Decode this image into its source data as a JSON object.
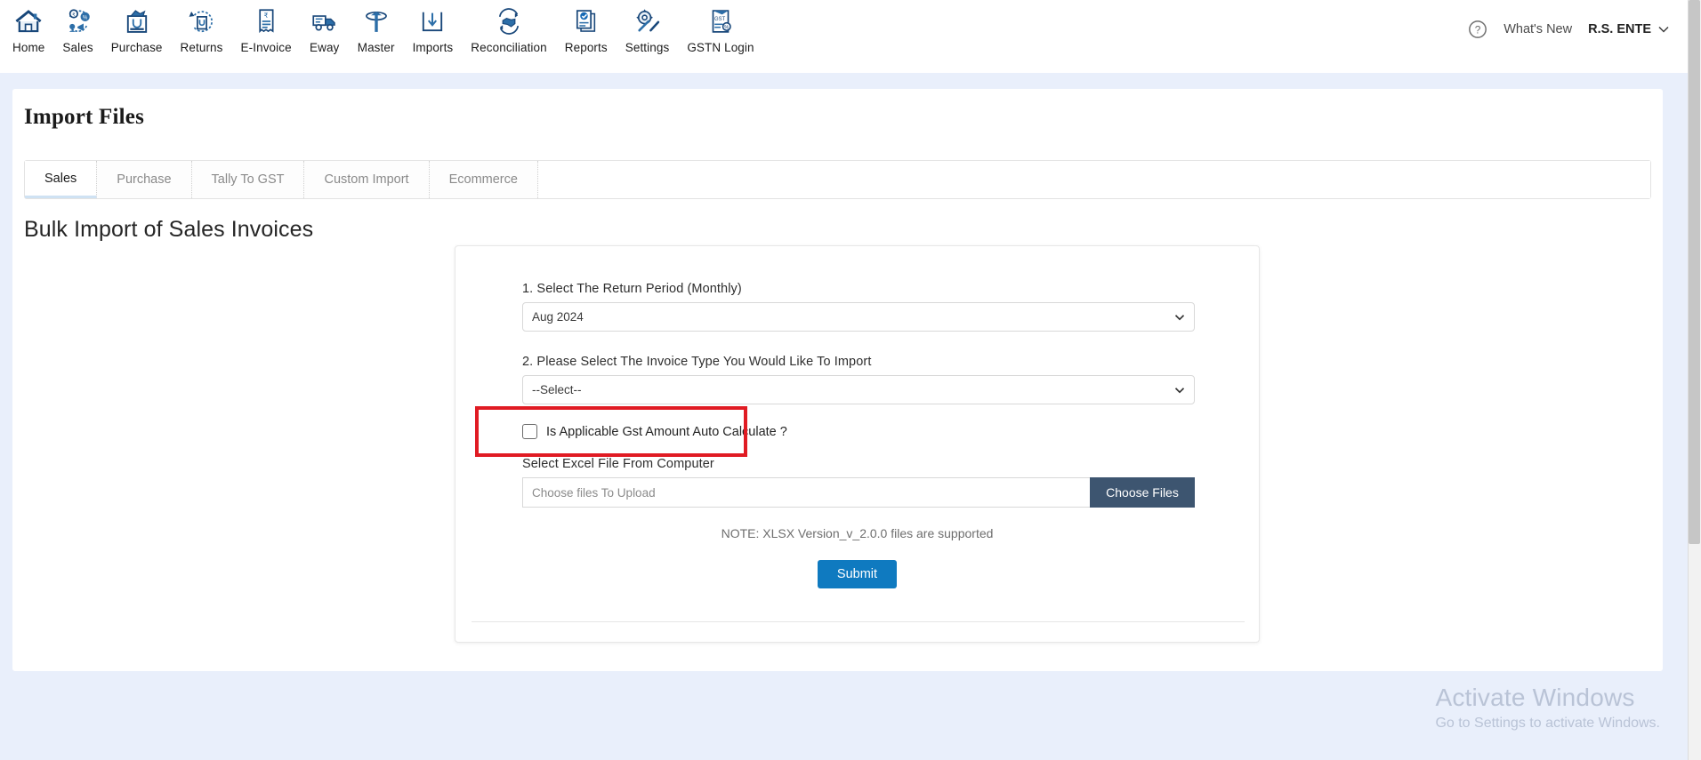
{
  "header": {
    "nav_items": [
      {
        "label": "Home",
        "icon": "home-icon"
      },
      {
        "label": "Sales",
        "icon": "sales-icon"
      },
      {
        "label": "Purchase",
        "icon": "purchase-icon"
      },
      {
        "label": "Returns",
        "icon": "returns-icon"
      },
      {
        "label": "E-Invoice",
        "icon": "e-invoice-icon"
      },
      {
        "label": "Eway",
        "icon": "eway-truck-icon"
      },
      {
        "label": "Master",
        "icon": "master-icon"
      },
      {
        "label": "Imports",
        "icon": "imports-download-icon"
      },
      {
        "label": "Reconciliation",
        "icon": "reconciliation-handshake-icon"
      },
      {
        "label": "Reports",
        "icon": "reports-icon"
      },
      {
        "label": "Settings",
        "icon": "settings-gear-wrench-icon"
      },
      {
        "label": "GSTN Login",
        "icon": "gstn-login-icon"
      }
    ],
    "help_icon": "help-circle-icon",
    "whats_new": "What's New",
    "user_name": "R.S. ENTE",
    "user_caret_icon": "chevron-down-icon"
  },
  "page": {
    "title": "Import Files",
    "section_title": "Bulk Import of Sales Invoices"
  },
  "tabs": [
    {
      "label": "Sales",
      "active": true
    },
    {
      "label": "Purchase",
      "active": false
    },
    {
      "label": "Tally To GST",
      "active": false
    },
    {
      "label": "Custom Import",
      "active": false
    },
    {
      "label": "Ecommerce",
      "active": false
    }
  ],
  "form": {
    "return_period": {
      "label": "1. Select The Return Period (Monthly)",
      "value": "Aug 2024",
      "chevron_icon": "chevron-down-icon"
    },
    "invoice_type": {
      "label": "2. Please Select The Invoice Type You Would Like To Import",
      "value": "--Select--",
      "chevron_icon": "chevron-down-icon"
    },
    "gst_auto_calculate": {
      "label": "Is Applicable Gst Amount Auto Calculate ?",
      "checked": false,
      "highlight_color": "#e01b23"
    },
    "file_upload": {
      "label": "Select Excel File From Computer",
      "placeholder": "Choose files To Upload",
      "value": "",
      "button_label": "Choose Files"
    },
    "note": "NOTE: XLSX Version_v_2.0.0 files are supported",
    "submit_label": "Submit"
  },
  "watermark": {
    "line1": "Activate Windows",
    "line2": "Go to Settings to activate Windows."
  },
  "colors": {
    "accent_blue": "#0f7ac0",
    "choose_button": "#3d5570",
    "page_background": "#e9effb",
    "highlight_red": "#e01b23"
  }
}
